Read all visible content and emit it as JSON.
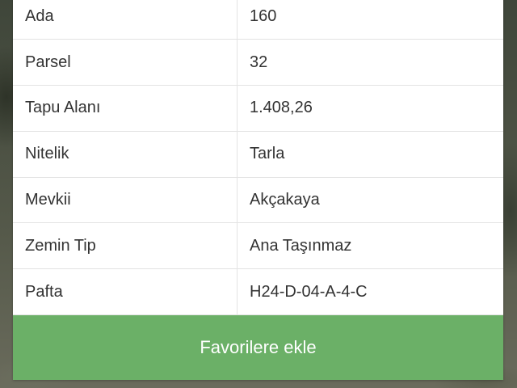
{
  "property": {
    "rows": [
      {
        "label": "Ada",
        "value": "160"
      },
      {
        "label": "Parsel",
        "value": "32"
      },
      {
        "label": "Tapu Alanı",
        "value": "1.408,26"
      },
      {
        "label": "Nitelik",
        "value": "Tarla"
      },
      {
        "label": "Mevkii",
        "value": "Akçakaya"
      },
      {
        "label": "Zemin Tip",
        "value": "Ana Taşınmaz"
      },
      {
        "label": "Pafta",
        "value": "H24-D-04-A-4-C"
      }
    ]
  },
  "actions": {
    "favorite_label": "Favorilere ekle"
  },
  "colors": {
    "accent_green": "#6bb067",
    "text": "#333333",
    "divider": "#e3e3e3"
  }
}
